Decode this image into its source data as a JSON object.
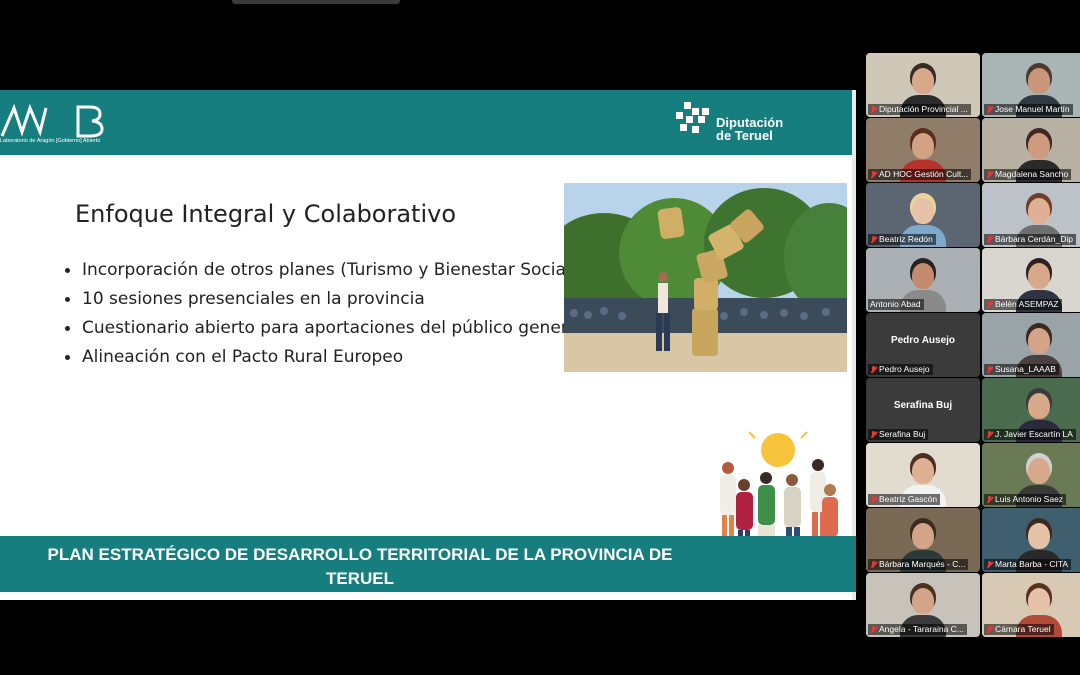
{
  "slide": {
    "logo_left_text": "Laboratorio de Aragón [Gobierno] Abierto",
    "logo_right_line1": "Diputación",
    "logo_right_line2": "de Teruel",
    "title": "Enfoque Integral y Colaborativo",
    "bullets": [
      "Incorporación de otros planes (Turismo y Bienestar Social)",
      "10 sesiones presenciales en la provincia",
      "Cuestionario abierto para aportaciones del público general",
      "Alineación con el Pacto Rural Europeo"
    ],
    "footer_line1": "PLAN ESTRATÉGICO DE DESARROLLO TERRITORIAL DE LA PROVINCIA DE",
    "footer_line2": "TERUEL"
  },
  "participants": [
    {
      "name": "Diputación Provincial ...",
      "muted": true
    },
    {
      "name": "Jose Manuel Martín",
      "muted": true
    },
    {
      "name": "AD HOC Gestión Cult...",
      "muted": true
    },
    {
      "name": "Magdalena Sancho",
      "muted": true
    },
    {
      "name": "Beatriz Redón",
      "muted": true
    },
    {
      "name": "Bárbara Cerdán_Dip",
      "muted": true
    },
    {
      "name": "Antonio Abad",
      "muted": false,
      "active": true
    },
    {
      "name": "Belén ASEMPAZ",
      "muted": true
    },
    {
      "name": "Pedro Ausejo",
      "muted": true,
      "video_off": true
    },
    {
      "name": "Susana_LAAAB",
      "muted": true
    },
    {
      "name": "Serafina Buj",
      "muted": true,
      "video_off": true
    },
    {
      "name": "J. Javier Escartín LA",
      "muted": true
    },
    {
      "name": "Beatriz Gascón",
      "muted": true
    },
    {
      "name": "Luis Antonio Saez",
      "muted": true
    },
    {
      "name": "Bárbara Marqués - C...",
      "muted": true
    },
    {
      "name": "Marta Barba - CITA",
      "muted": true
    },
    {
      "name": "Angela - Tararaina C...",
      "muted": true
    },
    {
      "name": "Cámara Teruel",
      "muted": true
    }
  ],
  "colors": {
    "teal": "#167e7f",
    "active_border": "#22c35a",
    "muted_icon": "#e03a3a"
  }
}
